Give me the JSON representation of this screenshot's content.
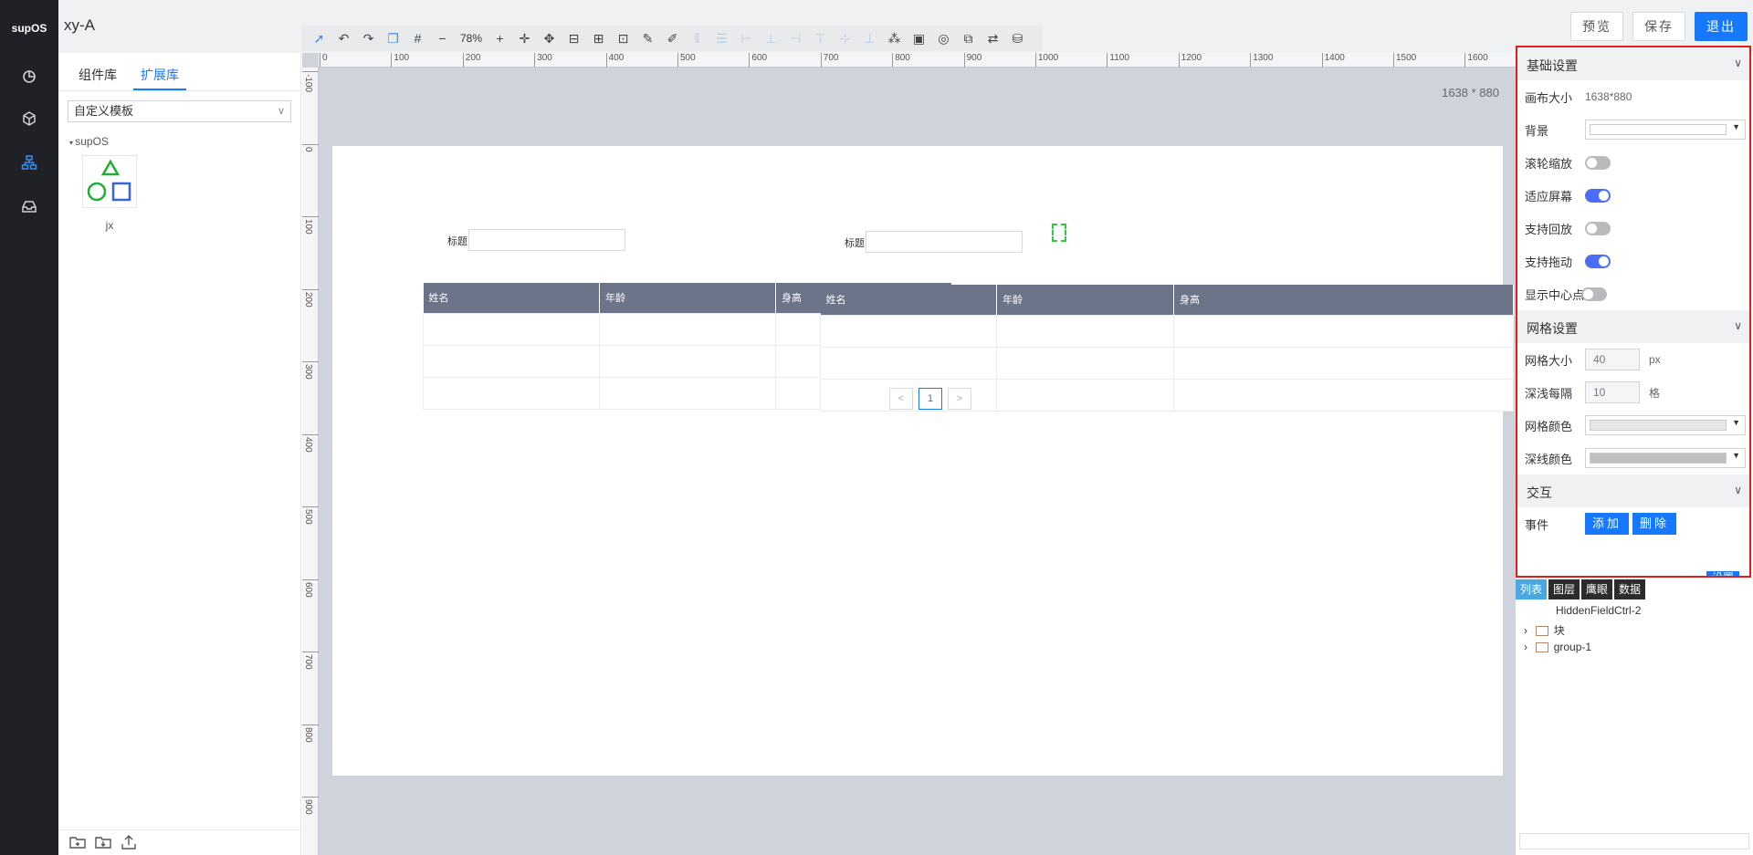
{
  "app": {
    "logo": "supOS",
    "title": "xy-A"
  },
  "toolbar": {
    "zoom": "78%"
  },
  "actions": {
    "preview": "预览",
    "save": "保存",
    "exit": "退出"
  },
  "left_panel": {
    "tabs": [
      "组件库",
      "扩展库"
    ],
    "active_tab": 1,
    "template_select": "自定义模板",
    "tree_root": "supOS",
    "component_label": "jx"
  },
  "canvas": {
    "size_label": "1638 * 880",
    "ruler_h": [
      "0",
      "100",
      "200",
      "300",
      "400",
      "500",
      "600",
      "700",
      "800",
      "900",
      "1000",
      "1100",
      "1200",
      "1300",
      "1400",
      "1500",
      "1600"
    ],
    "ruler_v": [
      "-100",
      "0",
      "100",
      "200",
      "300",
      "400",
      "500",
      "600",
      "700",
      "800",
      "900"
    ],
    "field_label_1": "标题",
    "field_label_2": "标题",
    "table_headers": [
      "姓名",
      "年龄",
      "身高"
    ],
    "pager": {
      "prev": "<",
      "page": "1",
      "next": ">"
    }
  },
  "props": {
    "basic": {
      "title": "基础设置",
      "canvas_size_label": "画布大小",
      "canvas_size_value": "1638*880",
      "background_label": "背景",
      "wheel_zoom_label": "滚轮缩放",
      "wheel_zoom": false,
      "fit_screen_label": "适应屏幕",
      "fit_screen": true,
      "playback_label": "支持回放",
      "playback": false,
      "drag_label": "支持拖动",
      "drag": true,
      "center_label": "显示中心点",
      "center": false
    },
    "grid": {
      "title": "网格设置",
      "size_label": "网格大小",
      "size_value": "40",
      "size_unit": "px",
      "interval_label": "深浅每隔",
      "interval_value": "10",
      "interval_unit": "格",
      "grid_color_label": "网格颜色",
      "grid_color": "#e6e6e6",
      "line_color_label": "深线颜色",
      "line_color": "#bfbfbf"
    },
    "interaction": {
      "title": "交互",
      "event_label": "事件",
      "add": "添加",
      "delete": "删除",
      "settings": "设置"
    }
  },
  "layers": {
    "tabs": [
      "列表",
      "图层",
      "鹰眼",
      "数据"
    ],
    "items": [
      "HiddenFieldCtrl-2",
      "块",
      "group-1"
    ]
  }
}
